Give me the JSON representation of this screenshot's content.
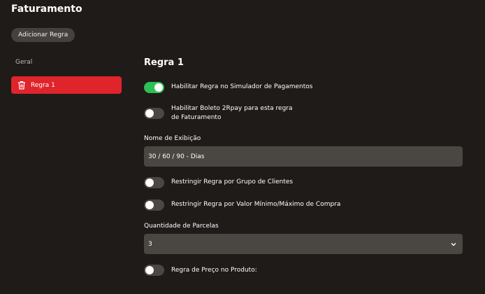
{
  "header": {
    "title": "Faturamento"
  },
  "toolbar": {
    "add_rule_label": "Adicionar Regra"
  },
  "sidebar": {
    "heading": "Geral",
    "items": [
      {
        "label": "Regra 1",
        "icon": "trash-icon",
        "active": true,
        "color": "#e0242b"
      }
    ]
  },
  "main": {
    "rule_title": "Regra 1",
    "toggles": [
      {
        "label": "Habilitar Regra no Simulador de Pagamentos",
        "on": true,
        "color": "#2fbf57"
      },
      {
        "label_line1": "Habilitar Boleto 2Rpay para esta regra",
        "label_line2": "de Faturamento",
        "on": false
      },
      {
        "label": "Restringir Regra por Grupo de Clientes",
        "on": false
      },
      {
        "label": "Restringir Regra por Valor Mínimo/Máximo de Compra",
        "on": false
      },
      {
        "label": "Regra de Preço no Produto:",
        "on": false
      }
    ],
    "display_name": {
      "label": "Nome de Exibição",
      "value": "30 / 60 / 90 - Dias"
    },
    "installments": {
      "label": "Quantidade de Parcelas",
      "value": "3",
      "icon": "chevron-down-icon"
    }
  }
}
